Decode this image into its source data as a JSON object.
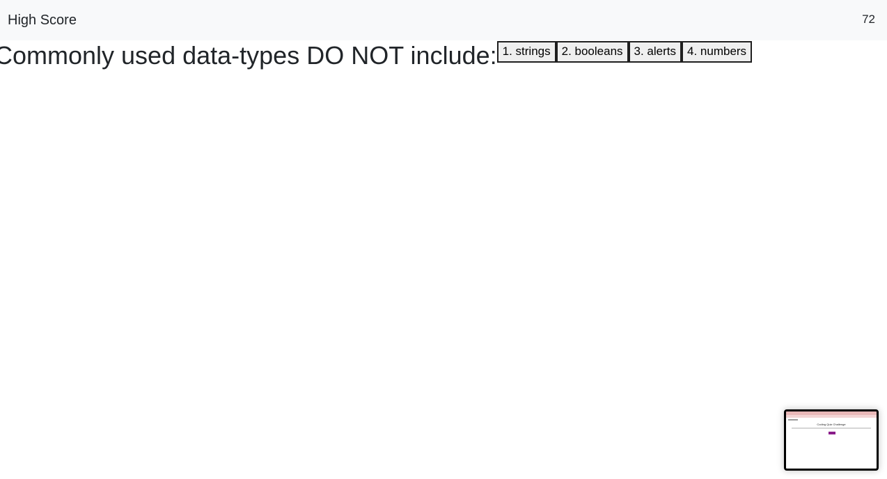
{
  "header": {
    "brand": "High Score",
    "timer": "72"
  },
  "quiz": {
    "question": "Commonly used data-types DO NOT include:",
    "choices": [
      "1. strings",
      "2. booleans",
      "3. alerts",
      "4. numbers"
    ]
  },
  "thumbnail": {
    "title": "Coding Quiz Challenge"
  }
}
